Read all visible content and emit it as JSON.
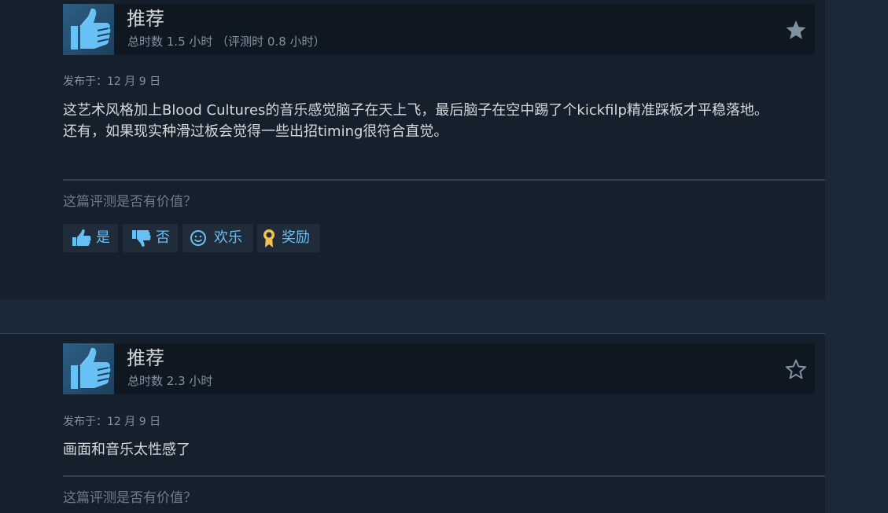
{
  "colors": {
    "page_bg": "#1b2838",
    "review_bg": "#16202d",
    "accent": "#66c0f4",
    "award_gold": "#f2c14e"
  },
  "reviews": [
    {
      "verdict": "推荐",
      "hours": "总时数 1.5 小时 （评测时 0.8 小时）",
      "posted": "发布于：12 月 9 日",
      "content": [
        "这艺术风格加上Blood Cultures的音乐感觉脑子在天上飞，最后脑子在空中踢了个kickfilp精准踩板才平稳落地。",
        "还有，如果现实种滑过板会觉得一些出招timing很符合直觉。"
      ],
      "helpful_question": "这篇评测是否有价值？",
      "star_icon": "star-filled-icon",
      "votes": {
        "yes": "是",
        "no": "否",
        "funny": "欢乐",
        "award": "奖励"
      }
    },
    {
      "verdict": "推荐",
      "hours": "总时数 2.3 小时",
      "posted": "发布于：12 月 9 日",
      "content": [
        "画面和音乐太性感了"
      ],
      "helpful_question": "这篇评测是否有价值？",
      "star_icon": "star-outline-icon"
    }
  ]
}
